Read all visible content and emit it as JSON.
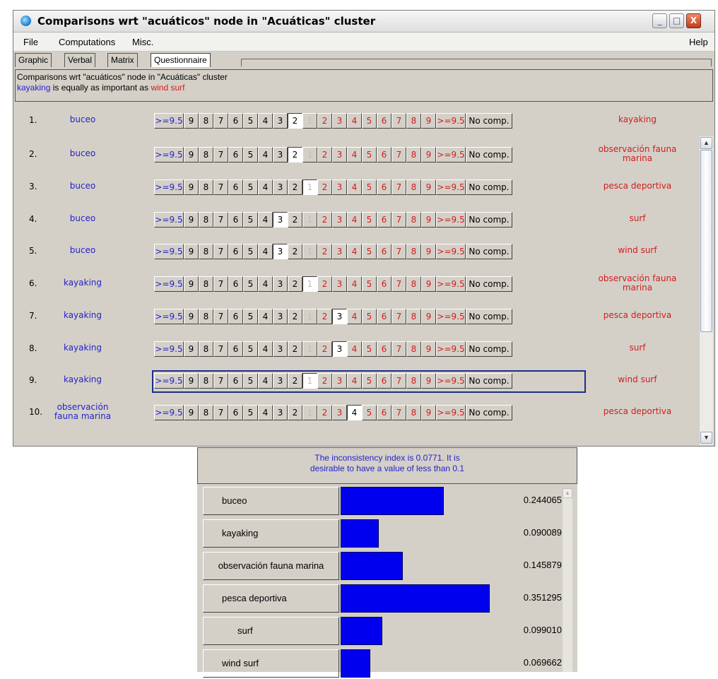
{
  "window": {
    "title": "Comparisons wrt \"acuáticos\" node in \"Acuáticas\" cluster",
    "controls": {
      "minimize": "_",
      "maximize": "□",
      "close": "X"
    }
  },
  "menu": {
    "file": "File",
    "computations": "Computations",
    "misc": "Misc.",
    "help": "Help"
  },
  "tabs": {
    "graphic": "Graphic",
    "verbal": "Verbal",
    "matrix": "Matrix",
    "questionnaire": "Questionnaire"
  },
  "info": {
    "line1": "Comparisons wrt \"acuáticos\" node in \"Acuáticas\" cluster",
    "line2_left": "kayaking",
    "line2_mid": " is equally as important as ",
    "line2_right": "wind surf"
  },
  "scale": {
    "left": [
      ">=9.5",
      "9",
      "8",
      "7",
      "6",
      "5",
      "4",
      "3",
      "2"
    ],
    "center": "1",
    "right": [
      "2",
      "3",
      "4",
      "5",
      "6",
      "7",
      "8",
      "9",
      ">=9.5"
    ],
    "nocomp": "No comp."
  },
  "rows": [
    {
      "num": "1.",
      "left": "buceo",
      "right": "kayaking",
      "sel": "L2"
    },
    {
      "num": "2.",
      "left": "buceo",
      "right": "observación fauna marina",
      "sel": "L2"
    },
    {
      "num": "3.",
      "left": "buceo",
      "right": "pesca deportiva",
      "sel": "C"
    },
    {
      "num": "4.",
      "left": "buceo",
      "right": "surf",
      "sel": "L3"
    },
    {
      "num": "5.",
      "left": "buceo",
      "right": "wind surf",
      "sel": "L3"
    },
    {
      "num": "6.",
      "left": "kayaking",
      "right": "observación fauna marina",
      "sel": "C"
    },
    {
      "num": "7.",
      "left": "kayaking",
      "right": "pesca deportiva",
      "sel": "R3"
    },
    {
      "num": "8.",
      "left": "kayaking",
      "right": "surf",
      "sel": "R3"
    },
    {
      "num": "9.",
      "left": "kayaking",
      "right": "wind surf",
      "sel": "C",
      "focused": true
    },
    {
      "num": "10.",
      "left": "observación fauna marina",
      "right": "pesca deportiva",
      "sel": "R4"
    }
  ],
  "results": {
    "header_line1": "The inconsistency index is 0.0771.  It is",
    "header_line2": "desirable to have a value of less than 0.1",
    "items": [
      {
        "label": "buceo",
        "value": "0.244065",
        "weight": 0.244065
      },
      {
        "label": "kayaking",
        "value": "0.090089",
        "weight": 0.090089
      },
      {
        "label": "observación fauna marina",
        "value": "0.145879",
        "weight": 0.145879
      },
      {
        "label": "pesca deportiva",
        "value": "0.351295",
        "weight": 0.351295
      },
      {
        "label": "surf",
        "value": "0.099010",
        "weight": 0.09901
      },
      {
        "label": "wind surf",
        "value": "0.069662",
        "weight": 0.069662
      }
    ]
  },
  "colors": {
    "left_node": "#2323c8",
    "right_node": "#d21c1c",
    "bar": "#0000ee"
  }
}
